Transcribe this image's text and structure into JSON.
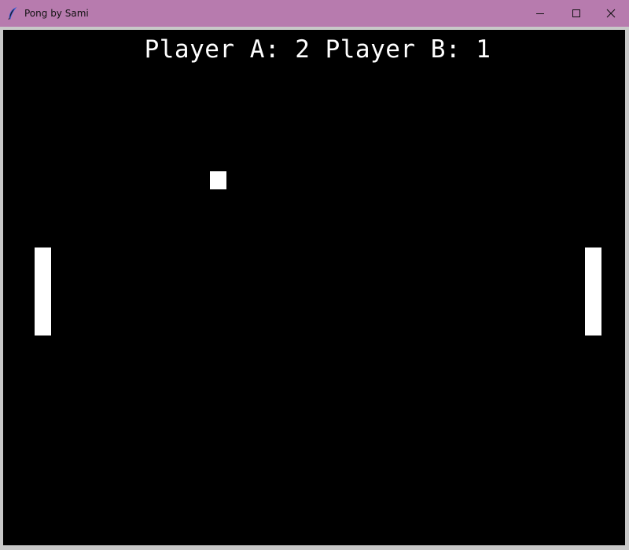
{
  "window": {
    "title": "Pong by Sami",
    "titlebar_color": "#b77bae",
    "icons": {
      "app": "feather-icon",
      "minimize": "minimize-icon",
      "maximize": "maximize-icon",
      "close": "close-icon"
    }
  },
  "game": {
    "background": "#000000",
    "foreground": "#ffffff",
    "score": {
      "player_a_label": "Player A:",
      "player_a_score": "2",
      "player_b_label": "Player B:",
      "player_b_score": "1"
    }
  }
}
